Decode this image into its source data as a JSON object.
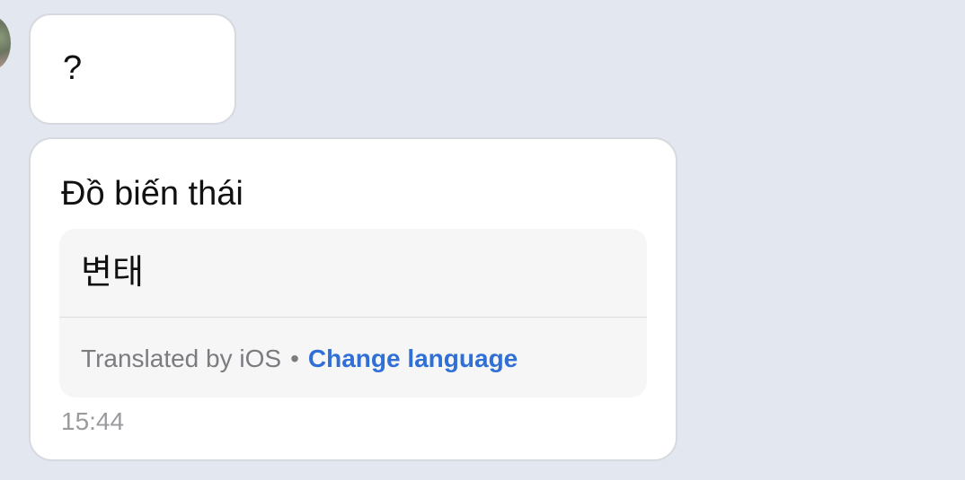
{
  "conversation": {
    "messages": [
      {
        "text": "?"
      },
      {
        "text": "Đồ biến thái",
        "translation": {
          "text": "변태",
          "provider_label": "Translated by iOS",
          "separator": "•",
          "change_language_label": "Change language"
        },
        "time": "15:44"
      }
    ]
  },
  "colors": {
    "background": "#e3e8f0",
    "bubble": "#ffffff",
    "link": "#2f6fd6",
    "muted_text": "#7b7b80"
  },
  "icons": {
    "avatar": "user-avatar"
  }
}
